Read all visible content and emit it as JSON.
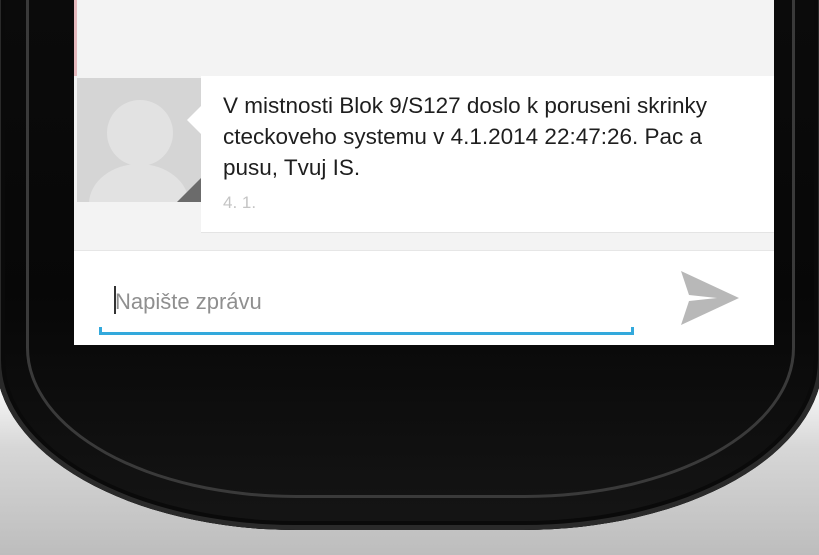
{
  "message": {
    "text": "V mistnosti Blok 9/S127 doslo k poruseni skrinky cteckoveho systemu v 4.1.2014 22:47:26. Pac a pusu, Tvuj IS.",
    "date": "4. 1."
  },
  "compose": {
    "placeholder": "Napište zprávu",
    "value": ""
  },
  "icons": {
    "send": "send-icon",
    "avatar": "default-contact-avatar"
  },
  "colors": {
    "accent": "#33a9dc",
    "send_icon": "#b8b8b8"
  }
}
